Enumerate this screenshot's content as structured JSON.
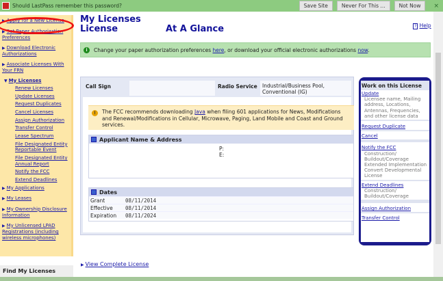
{
  "lastpass": {
    "message": "Should LastPass remember this password?",
    "buttons": [
      "Save Site",
      "Never For This ...",
      "Not Now"
    ],
    "close": "×"
  },
  "sidebar": {
    "items": [
      "Apply for a New License",
      "Set Paper Authorization Preferences",
      "Download Electronic Authorizations",
      "Associate Licenses With Your FRN"
    ],
    "my_licenses": "My Licenses",
    "sub": [
      "Renew Licenses",
      "Update Licenses",
      "Request Duplicates",
      "Cancel Licenses",
      "Assign Authorization",
      "Transfer Control",
      "Lease Spectrum",
      "File Designated Entity Reportable Event",
      "File Designated Entity Annual Report",
      "Notify the FCC",
      "Extend Deadlines"
    ],
    "items2": [
      "My Applications",
      "My Leases",
      "My Ownership Disclosure Information",
      "My Unlicensed LPAD Registrations (including wireless microphones)"
    ],
    "find": "Find My Licenses"
  },
  "header": {
    "title": "My Licenses",
    "subtitle_left": "License",
    "subtitle_right": "At A Glance",
    "help": "Help"
  },
  "notice": {
    "pre": "Change your paper authorization preferences ",
    "link1": "here",
    "mid": ", or download your official electronic authorizations ",
    "link2": "now",
    "post": "."
  },
  "license": {
    "call_sign_label": "Call Sign",
    "call_sign": "",
    "radio_service_label": "Radio Service",
    "radio_service": "Industrial/Business Pool, Conventional (IG)",
    "warning_pre": "The FCC recommends downloading ",
    "warning_link": "Java",
    "warning_post": " when filing 601 applications for News, Modifications and Renewal/Modifications in Cellular, Microwave, Paging, Land Mobile and Coast and Ground services.",
    "applicant_title": "Applicant Name & Address",
    "phone_label": "P:",
    "email_label": "E:",
    "dates_title": "Dates",
    "dates": [
      {
        "k": "Grant",
        "v": "08/11/2014"
      },
      {
        "k": "Effective",
        "v": "08/11/2014"
      },
      {
        "k": "Expiration",
        "v": "08/11/2024"
      }
    ]
  },
  "work": {
    "title": "Work on this License",
    "update": "Update",
    "update_desc": "Licensee name, Mailing address, Locations, Antennas, Frequencies, and other license data",
    "dup": "Request Duplicate",
    "cancel": "Cancel",
    "notify": "Notify the FCC",
    "notify_desc": "Construction/ Buildout/Coverage Extended Implementation Convert Developmental License",
    "extend": "Extend Deadlines",
    "extend_desc": "Construction/ Buildout/Coverage",
    "assign": "Assign Authorization",
    "transfer": "Transfer Control"
  },
  "view_complete": "View Complete License"
}
